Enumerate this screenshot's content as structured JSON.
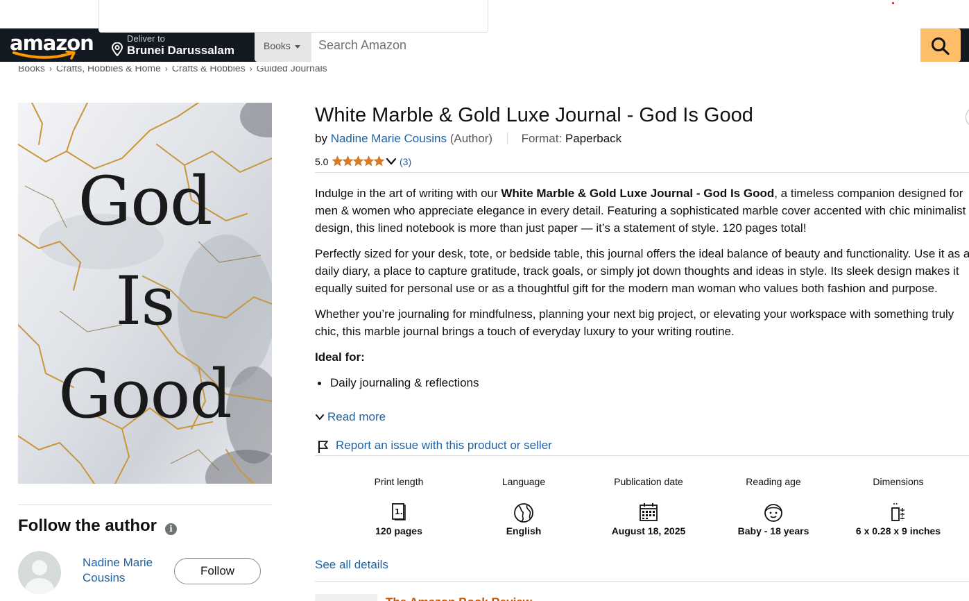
{
  "nav": {
    "logo_text": "amazon",
    "deliver_line1": "Deliver to",
    "deliver_line2": "Brunei Darussalam",
    "search_category": "Books",
    "search_placeholder": "Search Amazon"
  },
  "breadcrumb": [
    "Books",
    "Crafts, Hobbies & Home",
    "Crafts & Hobbies",
    "Guided Journals"
  ],
  "cover": {
    "words": [
      "God",
      "Is",
      "Good"
    ]
  },
  "product": {
    "title": "White Marble & Gold Luxe Journal - God Is Good",
    "by": "by",
    "author": "Nadine Marie Cousins",
    "role": "(Author)",
    "format_label": "Format:",
    "format_value": "Paperback",
    "rating_value": "5.0",
    "rating_stars": 5,
    "rating_count": "(3)"
  },
  "description": {
    "p1_pre": "Indulge in the art of writing with our ",
    "p1_bold": "White Marble & Gold Luxe Journal - God Is Good",
    "p1_post": ", a timeless companion designed for men & women who appreciate elegance in every detail. Featuring a sophisticated marble cover accented with chic minimalist design, this lined notebook is more than just paper — it’s a statement of style. 120 pages total!",
    "p2": "Perfectly sized for your desk, tote, or bedside table, this journal offers the ideal balance of beauty and functionality. Use it as a daily diary, a place to capture gratitude, track goals, or simply jot down thoughts and ideas in style. Its sleek design makes it equally suited for personal use or as a thoughtful gift for the modern man woman who values both fashion and purpose.",
    "p3": "Whether you’re journaling for mindfulness, planning your next big project, or elevating your workspace with something truly chic, this marble journal brings a touch of everyday luxury to your writing routine.",
    "ideal_heading": "Ideal for:",
    "bullet1": "Daily journaling & reflections",
    "read_more": "Read more"
  },
  "report_link": "Report an issue with this product or seller",
  "details": [
    {
      "label": "Print length",
      "icon": "book-page-icon",
      "value": "120 pages"
    },
    {
      "label": "Language",
      "icon": "globe-icon",
      "value": "English"
    },
    {
      "label": "Publication date",
      "icon": "calendar-icon",
      "value": "August 18, 2025"
    },
    {
      "label": "Reading age",
      "icon": "baby-face-icon",
      "value": "Baby - 18 years"
    },
    {
      "label": "Dimensions",
      "icon": "ruler-icon",
      "value": "6 x 0.28 x 9 inches"
    }
  ],
  "see_all_details": "See all details",
  "follow": {
    "title": "Follow the author",
    "info_glyph": "i",
    "author_name": "Nadine Marie Cousins",
    "button": "Follow"
  },
  "peek_heading": "The Amazon Book Review",
  "colors": {
    "nav_bg": "#131921",
    "search_button": "#febd69",
    "link": "#2162a1",
    "star": "#de7921",
    "text": "#0f1111"
  }
}
